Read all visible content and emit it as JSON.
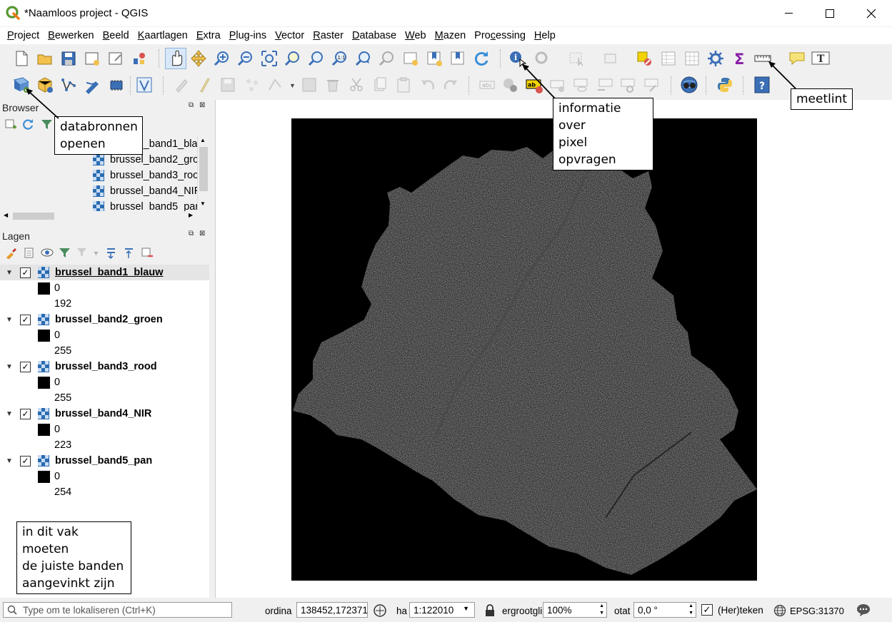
{
  "window": {
    "title": "*Naamloos project - QGIS",
    "minimize": "—",
    "maximize": "☐",
    "close": "✕"
  },
  "menu": [
    {
      "label": "Project",
      "u": "P",
      "rest": "roject"
    },
    {
      "label": "Bewerken",
      "u": "B",
      "rest": "ewerken"
    },
    {
      "label": "Beeld",
      "u": "B",
      "rest": "eeld"
    },
    {
      "label": "Kaartlagen",
      "u": "K",
      "rest": "aartlagen"
    },
    {
      "label": "Extra",
      "u": "E",
      "rest": "xtra"
    },
    {
      "label": "Plug-ins",
      "u": "P",
      "rest": "lug-ins"
    },
    {
      "label": "Vector",
      "u": "V",
      "rest": "ector"
    },
    {
      "label": "Raster",
      "u": "R",
      "rest": "aster"
    },
    {
      "label": "Database",
      "u": "D",
      "rest": "atabase"
    },
    {
      "label": "Web",
      "u": "W",
      "rest": "eb"
    },
    {
      "label": "Mazen",
      "u": "M",
      "rest": "azen"
    },
    {
      "label": "Processing",
      "pre": "Pro",
      "u": "c",
      "rest": "essing"
    },
    {
      "label": "Help",
      "u": "H",
      "rest": "elp"
    }
  ],
  "browser": {
    "title": "Browser",
    "items": [
      {
        "label": "brussel_band1_bla"
      },
      {
        "label": "brussel_band2_gro"
      },
      {
        "label": "brussel_band3_roo"
      },
      {
        "label": "brussel_band4_NIR"
      },
      {
        "label": "brussel_band5_par"
      }
    ]
  },
  "layers": {
    "title": "Lagen",
    "items": [
      {
        "name": "brussel_band1_blauw",
        "min": "0",
        "max": "192",
        "checked": true,
        "underline": true
      },
      {
        "name": "brussel_band2_groen",
        "min": "0",
        "max": "255",
        "checked": true
      },
      {
        "name": "brussel_band3_rood",
        "min": "0",
        "max": "255",
        "checked": true
      },
      {
        "name": "brussel_band4_NIR",
        "min": "0",
        "max": "223",
        "checked": true
      },
      {
        "name": "brussel_band5_pan",
        "min": "0",
        "max": "254",
        "checked": true
      }
    ]
  },
  "callouts": {
    "databronnen": [
      "databronnen",
      "openen"
    ],
    "informatie": [
      "informatie over",
      "pixel opvragen"
    ],
    "meetlint": "meetlint",
    "vak": [
      "in dit vak moeten",
      "de juiste banden",
      "aangevinkt zijn"
    ]
  },
  "status": {
    "locator_placeholder": "Type om te lokaliseren (Ctrl+K)",
    "coord_label": "ordina",
    "coord_value": "138452,172371",
    "scale_label": "ha",
    "scale_value": "1:122010",
    "magnifier_label": "ergrootgli",
    "magnifier_value": "100%",
    "rotation_label": "otat",
    "rotation_value": "0,0 °",
    "render_label": "(Her)teken",
    "crs": "EPSG:31370"
  },
  "colors": {
    "accent": "#2b6cb0",
    "qgis_green": "#589632",
    "qgis_yellow": "#ee7913"
  }
}
